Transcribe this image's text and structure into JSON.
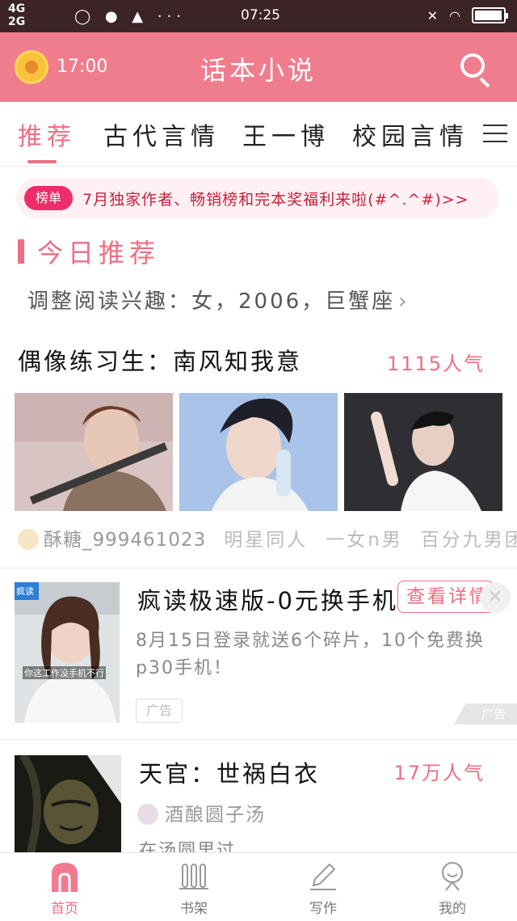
{
  "status_bar": {
    "signal_top": "4G",
    "signal_bottom": "2G",
    "icons": "◯ ● ▲ ···",
    "time": "07:25"
  },
  "app_bar": {
    "alarm_time": "17:00",
    "title": "话本小说"
  },
  "tabs": [
    {
      "label": "推荐",
      "active": true
    },
    {
      "label": "古代言情",
      "active": false
    },
    {
      "label": "王一博",
      "active": false
    },
    {
      "label": "校园言情",
      "active": false
    }
  ],
  "notice": {
    "badge": "榜单",
    "text": "7月独家作者、畅销榜和完本奖福利来啦(#^.^#)>>"
  },
  "today_section": {
    "title": "今日推荐",
    "preference": "调整阅读兴趣：女，2006，巨蟹座"
  },
  "book1": {
    "title": "偶像练习生：南风知我意",
    "popularity": "1115人气",
    "author": "酥糖_999461023",
    "tags": [
      "明星同人",
      "一女n男",
      "百分九男团"
    ]
  },
  "ad": {
    "title": "疯读极速版-0元换手机",
    "button": "查看详情",
    "description": "8月15日登录就送6个碎片，10个免费换p30手机！",
    "tag": "广告",
    "thumb_logo": "疯读",
    "thumb_caption": "你这工作没手机不行",
    "mark": "广告"
  },
  "book2": {
    "title": "天官：世祸白衣",
    "popularity": "17万人气",
    "author": "酒酿圆子汤",
    "description": "在汤圆里过"
  },
  "bottom_nav": [
    {
      "label": "首页",
      "active": true
    },
    {
      "label": "书架",
      "active": false
    },
    {
      "label": "写作",
      "active": false
    },
    {
      "label": "我的",
      "active": false
    }
  ],
  "colors": {
    "accent": "#ef6e83",
    "appbar": "#ef7d8e",
    "status_bar": "#3b2326",
    "badge": "#ee2c68"
  }
}
